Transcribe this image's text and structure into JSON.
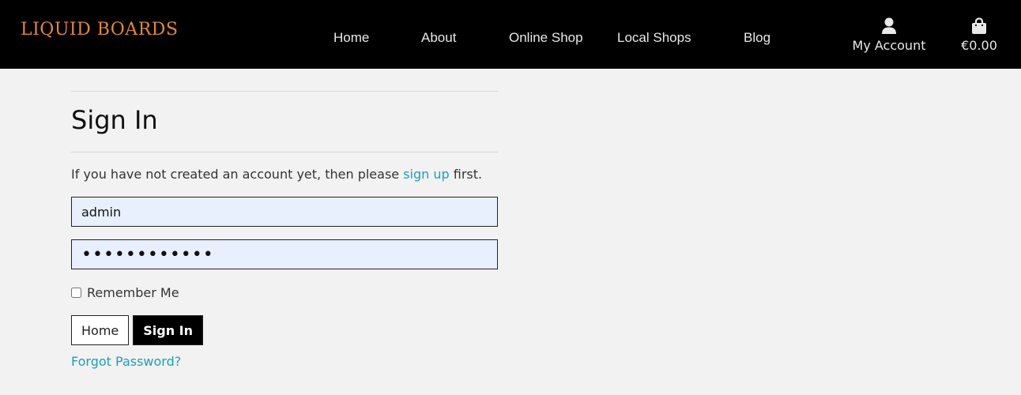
{
  "header": {
    "logo": "LIQUID BOARDS",
    "nav": [
      {
        "label": "Home"
      },
      {
        "label": "About"
      },
      {
        "label": "Online Shop"
      },
      {
        "label": "Local Shops"
      },
      {
        "label": "Blog"
      }
    ],
    "account_label": "My Account",
    "account_icon": "user-icon",
    "cart_total": "€0.00",
    "cart_icon": "shopping-bag-icon"
  },
  "main": {
    "title": "Sign In",
    "intro_prefix": "If you have not created an account yet, then please ",
    "intro_link": "sign up",
    "intro_suffix": " first.",
    "username_value": "admin",
    "password_value": "••••••••••••",
    "remember_label": "Remember Me",
    "home_button": "Home",
    "signin_button": "Sign In",
    "forgot_link": "Forgot Password?"
  },
  "colors": {
    "header_bg": "#000000",
    "logo": "#e08a2e",
    "link": "#17a2b8",
    "input_bg": "#e8f0fe",
    "page_bg": "#f2f2f2"
  }
}
